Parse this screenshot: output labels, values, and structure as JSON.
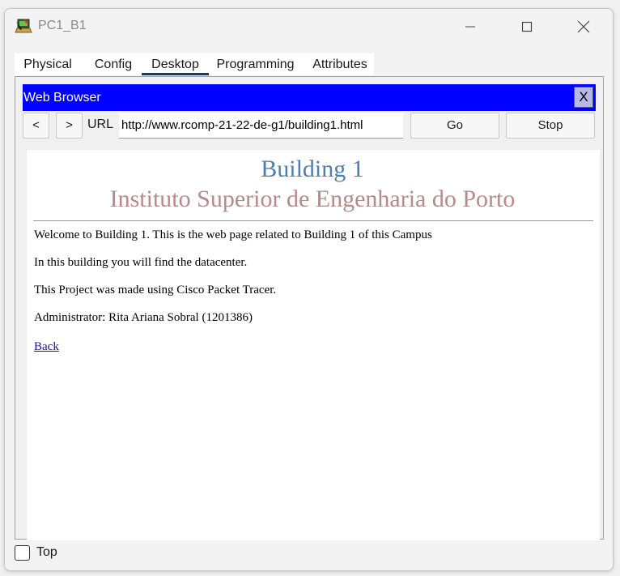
{
  "window": {
    "title": "PC1_B1",
    "icon": "packet-tracer-pc-icon",
    "controls": [
      "minimize-icon",
      "maximize-icon",
      "close-icon"
    ]
  },
  "tabs": [
    {
      "label": "Physical",
      "active": false
    },
    {
      "label": "Config",
      "active": false
    },
    {
      "label": "Desktop",
      "active": true
    },
    {
      "label": "Programming",
      "active": false
    },
    {
      "label": "Attributes",
      "active": false
    }
  ],
  "browser": {
    "title": "Web Browser",
    "close_label": "X",
    "back_label": "<",
    "forward_label": ">",
    "url_label": "URL",
    "url_value": "http://www.rcomp-21-22-de-g1/building1.html",
    "go_label": "Go",
    "stop_label": "Stop",
    "title_bar_color": "#0000ff"
  },
  "page": {
    "heading": "Building 1",
    "subheading": "Instituto Superior de Engenharia do Porto",
    "heading_color": "#4e7fad",
    "subheading_color": "#b8898a",
    "paragraphs": [
      "Welcome to Building 1. This is the web page related to Building 1 of this Campus",
      "In this building you will find the datacenter.",
      "This Project was made using Cisco Packet Tracer.",
      "Administrator: Rita Ariana Sobral (1201386)"
    ],
    "back_link": "Back"
  },
  "footer": {
    "top_label": "Top",
    "top_checked": false
  }
}
